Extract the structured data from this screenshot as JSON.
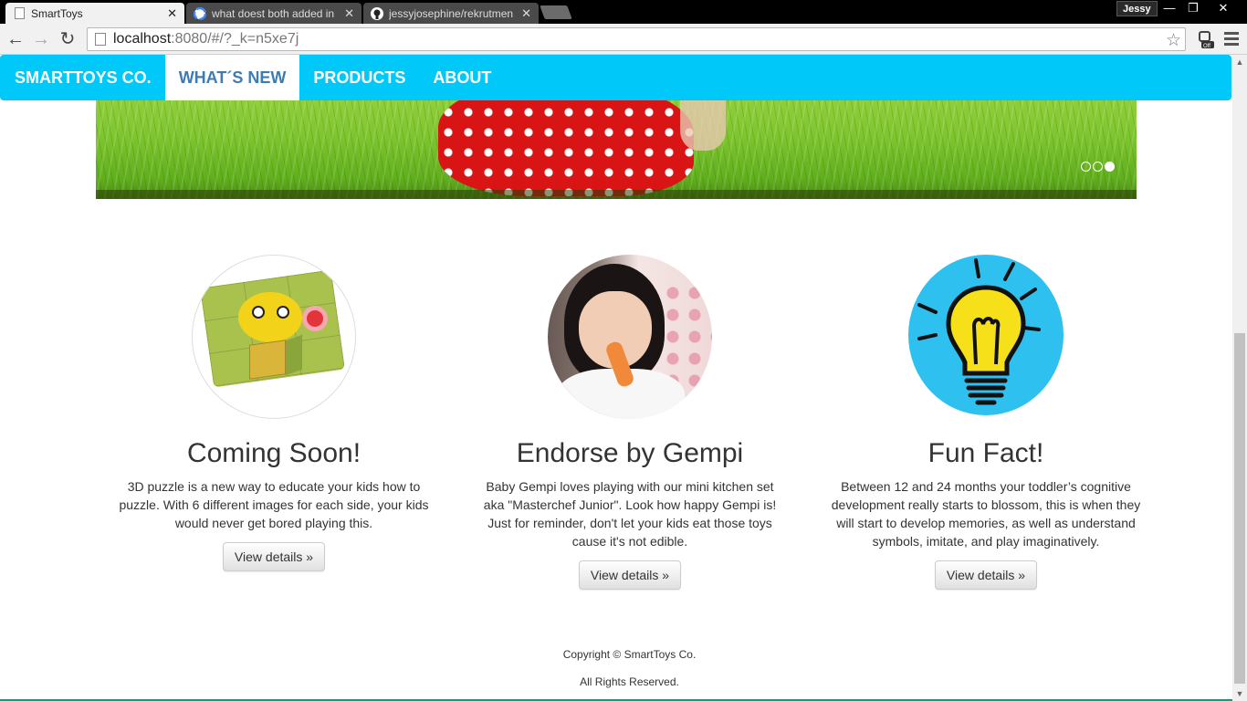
{
  "browser": {
    "tabs": [
      {
        "title": "SmartToys",
        "active": true,
        "icon": "page-icon"
      },
      {
        "title": "what doest both added in",
        "active": false,
        "icon": "google-icon"
      },
      {
        "title": "jessyjosephine/rekrutmen",
        "active": false,
        "icon": "github-icon"
      }
    ],
    "profile_name": "Jessy",
    "url_host": "localhost",
    "url_rest": ":8080/#/?_k=n5xe7j"
  },
  "nav": {
    "brand": "SMARTTOYS CO.",
    "items": [
      {
        "label": "WHAT´S NEW",
        "active": true
      },
      {
        "label": "PRODUCTS",
        "active": false
      },
      {
        "label": "ABOUT",
        "active": false
      }
    ],
    "color": "#00c8f8"
  },
  "carousel": {
    "slide_count": 3,
    "active_slide": 3
  },
  "features": [
    {
      "title": "Coming Soon!",
      "text": "3D puzzle is a new way to educate your kids how to puzzle. With 6 different images for each side, your kids would never get bored playing this.",
      "button": "View details »",
      "image": "puzzle-cube-image"
    },
    {
      "title": "Endorse by Gempi",
      "text": "Baby Gempi loves playing with our mini kitchen set aka \"Masterchef Junior\". Look how happy Gempi is! Just for reminder, don't let your kids eat those toys cause it's not edible.",
      "button": "View details »",
      "image": "gempi-photo"
    },
    {
      "title": "Fun Fact!",
      "text": "Between 12 and 24 months your toddler’s cognitive development really starts to blossom, this is when they will start to develop memories, as well as understand symbols, imitate, and play imaginatively.",
      "button": "View details »",
      "image": "lightbulb-icon"
    }
  ],
  "footer": {
    "copyright": "Copyright © SmartToys Co.",
    "rights": "All Rights Reserved."
  }
}
